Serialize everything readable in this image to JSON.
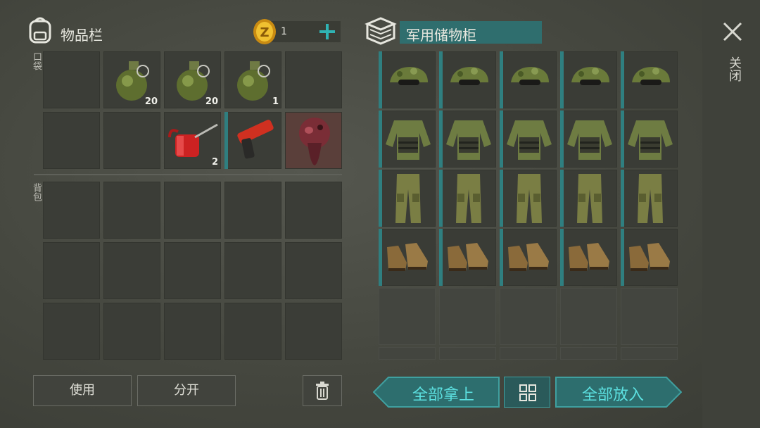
{
  "inventory": {
    "title": "物品栏",
    "pocket_label": "口袋",
    "backpack_label": "背包",
    "coins": "1",
    "pocket_items": [
      {
        "slot": 1,
        "icon": "grenade-icon",
        "qty": "20"
      },
      {
        "slot": 2,
        "icon": "grenade-icon",
        "qty": "20"
      },
      {
        "slot": 3,
        "icon": "grenade-icon",
        "qty": "1"
      },
      {
        "slot": 7,
        "icon": "oil-can-icon",
        "qty": "2"
      },
      {
        "slot": 8,
        "icon": "flare-gun-icon",
        "qty": ""
      },
      {
        "slot": 9,
        "icon": "creature-head-icon",
        "qty": ""
      }
    ],
    "buttons": {
      "use": "使用",
      "split": "分开"
    }
  },
  "storage": {
    "title": "军用储物柜",
    "rows": [
      {
        "icon": "camo-cap-icon"
      },
      {
        "icon": "camo-jacket-icon"
      },
      {
        "icon": "camo-pants-icon"
      },
      {
        "icon": "boots-icon"
      }
    ],
    "buttons": {
      "take_all": "全部拿上",
      "put_all": "全部放入"
    }
  },
  "close_label": "关闭",
  "colors": {
    "accent": "#2f7f80",
    "teal_text": "#5ce0e0",
    "coin": "#e0b020"
  }
}
